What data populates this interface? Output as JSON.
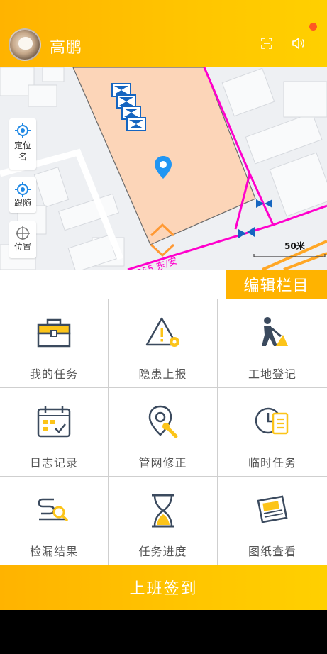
{
  "header": {
    "username": "高鹏",
    "scan_icon": "scan-icon",
    "speaker_icon": "speaker-icon",
    "notification": "notification-dot"
  },
  "map": {
    "controls": [
      {
        "label": "定位名",
        "icon": "locate-icon"
      },
      {
        "label": "跟随",
        "icon": "follow-icon"
      },
      {
        "label": "位置",
        "icon": "position-icon"
      }
    ],
    "scale": "50米",
    "road_label": "J255 东/安"
  },
  "edit_button": "编辑栏目",
  "menu": [
    {
      "label": "我的任务",
      "icon": "briefcase-icon"
    },
    {
      "label": "隐患上报",
      "icon": "warning-icon"
    },
    {
      "label": "工地登记",
      "icon": "worker-icon"
    },
    {
      "label": "日志记录",
      "icon": "calendar-icon"
    },
    {
      "label": "管网修正",
      "icon": "pin-wrench-icon"
    },
    {
      "label": "临时任务",
      "icon": "clock-list-icon"
    },
    {
      "label": "检漏结果",
      "icon": "leak-search-icon"
    },
    {
      "label": "任务进度",
      "icon": "hourglass-icon"
    },
    {
      "label": "图纸查看",
      "icon": "drawing-icon"
    }
  ],
  "checkin_button": "上班签到",
  "colors": {
    "accent": "#ffb300",
    "pipe": "#ff00cc",
    "zone": "#fcd5b8",
    "icon_dark": "#3b4a5e",
    "icon_yellow": "#fcc419"
  }
}
